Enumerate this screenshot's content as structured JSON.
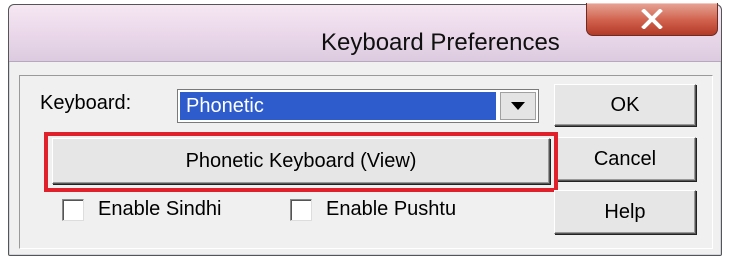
{
  "window": {
    "title": "Keyboard Preferences"
  },
  "keyboard": {
    "label": "Keyboard:",
    "selected": "Phonetic"
  },
  "buttons": {
    "phonetic_view": "Phonetic Keyboard (View)",
    "ok": "OK",
    "cancel": "Cancel",
    "help": "Help"
  },
  "checkboxes": [
    {
      "label": "Enable Sindhi",
      "checked": false
    },
    {
      "label": "Enable Pushtu",
      "checked": false
    }
  ],
  "colors": {
    "highlight": "#e0202a",
    "selection": "#2e5ccd",
    "close": "#c84a36"
  },
  "icons": {
    "close": "close-icon",
    "dropdown": "chevron-down-icon"
  }
}
